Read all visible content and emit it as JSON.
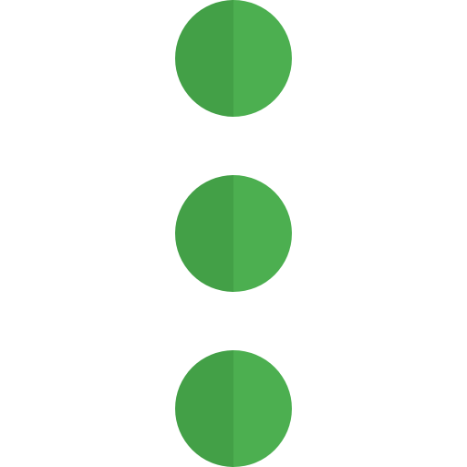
{
  "icon": {
    "name": "more-vertical-icon",
    "dot_count": 3,
    "colors": {
      "left_half": "#43a047",
      "right_half": "#4caf50",
      "background": "#ffffff"
    }
  }
}
